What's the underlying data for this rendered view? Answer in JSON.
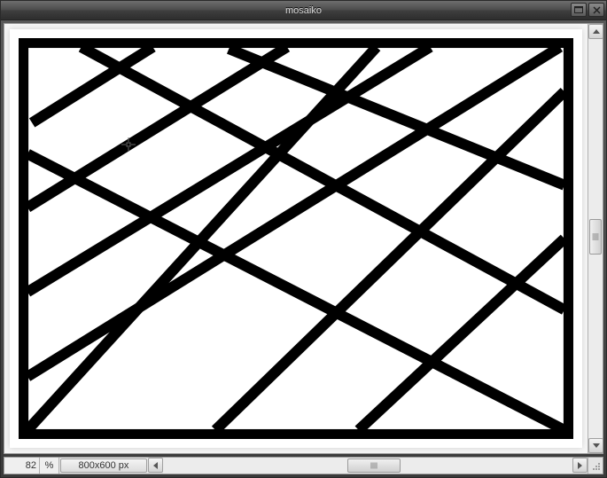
{
  "window": {
    "title": "mosaiko"
  },
  "status": {
    "zoom_value": "82",
    "zoom_unit": "%",
    "canvas_dimensions": "800x600 px"
  }
}
